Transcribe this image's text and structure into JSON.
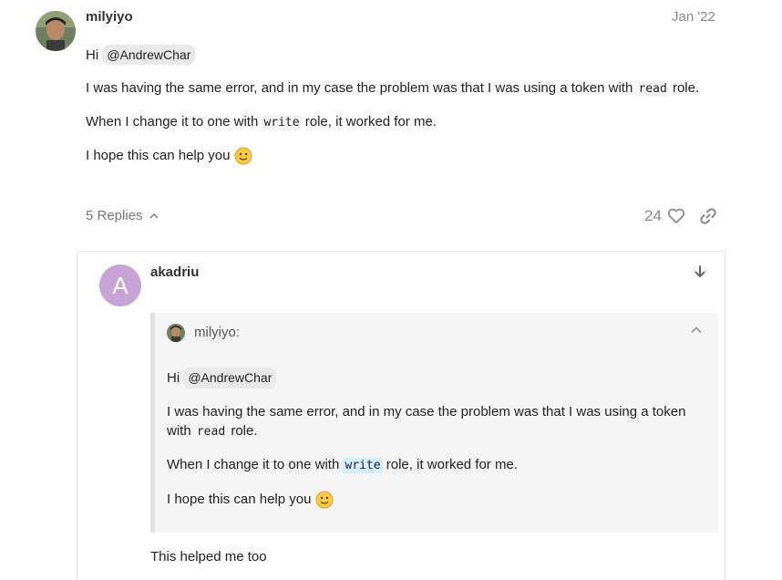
{
  "post": {
    "username": "milyiyo",
    "date": "Jan '22",
    "greeting": "Hi",
    "mention": "@AndrewChar",
    "p1_before": "I was having the same error, and in my case the problem was that I was using a token with",
    "p1_code": "read",
    "p1_after": "role.",
    "p2_before": "When I change it to one with",
    "p2_code": "write",
    "p2_after": "role, it worked for me.",
    "p3": "I hope this can help you",
    "replies_label": "5 Replies",
    "likes": "24",
    "colors": {
      "mention_bg": "#e9e9e9",
      "muted": "#777777"
    }
  },
  "reply": {
    "avatar_letter": "A",
    "avatar_color": "#c9a3d8",
    "username": "akadriu",
    "quote": {
      "author": "milyiyo:",
      "greeting": "Hi",
      "mention": "@AndrewChar",
      "p1_line1": "I was having the same error, and in my case the problem was that I was using a token",
      "p1_line2_before": "with",
      "p1_code": "read",
      "p1_after": "role.",
      "p2_before": "When I change it to one with",
      "p2_code": "write",
      "p2_after": "role, it worked for me.",
      "p3": "I hope this can help you"
    },
    "body": "This helped me too"
  }
}
